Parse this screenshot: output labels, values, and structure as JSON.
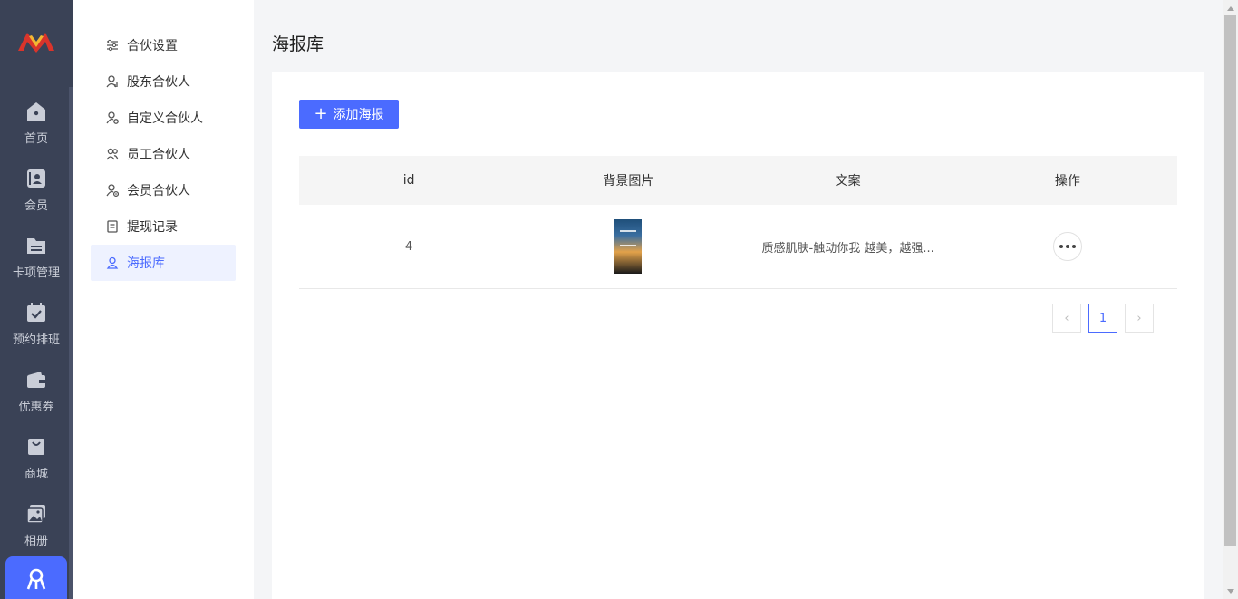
{
  "rail": {
    "items": [
      {
        "label": "首页",
        "icon": "home-icon"
      },
      {
        "label": "会员",
        "icon": "member-card-icon"
      },
      {
        "label": "卡项管理",
        "icon": "folder-icon"
      },
      {
        "label": "预约排班",
        "icon": "calendar-check-icon"
      },
      {
        "label": "优惠券",
        "icon": "wallet-icon"
      },
      {
        "label": "商城",
        "icon": "shopping-bag-icon"
      },
      {
        "label": "相册",
        "icon": "gallery-icon"
      }
    ],
    "active_icon": "partner-icon"
  },
  "subnav": {
    "items": [
      {
        "label": "合伙设置",
        "icon": "sliders-icon"
      },
      {
        "label": "股东合伙人",
        "icon": "shareholder-icon"
      },
      {
        "label": "自定义合伙人",
        "icon": "custom-partner-icon"
      },
      {
        "label": "员工合伙人",
        "icon": "staff-partner-icon"
      },
      {
        "label": "会员合伙人",
        "icon": "member-partner-icon"
      },
      {
        "label": "提现记录",
        "icon": "document-icon"
      },
      {
        "label": "海报库",
        "icon": "user-icon",
        "active": true
      }
    ]
  },
  "page": {
    "title": "海报库",
    "add_button": "添加海报"
  },
  "table": {
    "columns": [
      "id",
      "背景图片",
      "文案",
      "操作"
    ],
    "rows": [
      {
        "id": "4",
        "copy": "质感肌肤-触动你我 越美，越强..."
      }
    ]
  },
  "pagination": {
    "current": "1",
    "prev": "‹",
    "next": "›"
  },
  "colors": {
    "accent": "#4b6bff",
    "rail_bg": "#3a4256"
  }
}
